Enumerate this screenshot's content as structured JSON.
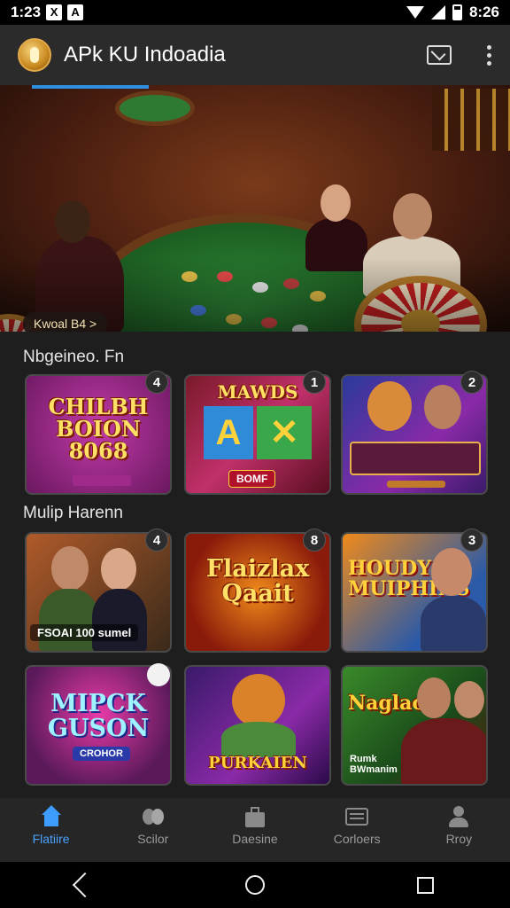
{
  "status_bar": {
    "time": "1:23",
    "right_time": "8:26",
    "notif_icons": [
      "X",
      "A"
    ]
  },
  "app_bar": {
    "title": "APk KU Indoadia",
    "icons": [
      "mail-icon",
      "more-vert-icon"
    ]
  },
  "banner": {
    "chip_label": "Kwoal B4 >"
  },
  "sections": [
    {
      "title": "Nbgeineo. Fn"
    },
    {
      "title": "Mulip Harenn"
    }
  ],
  "cards": [
    {
      "title": "CHILBH\nBOION\n8068",
      "sub": "",
      "badge": "4"
    },
    {
      "title": "MAWDS",
      "sub": "BOMF",
      "badge": "1"
    },
    {
      "title": "",
      "sub": "",
      "badge": "2"
    },
    {
      "title": "",
      "sub": "FSOAI 100 sumel",
      "badge": "4"
    },
    {
      "title": "Flaizlax\nQaait",
      "sub": "",
      "badge": "8"
    },
    {
      "title": "HOUDY\nMUIPHINS",
      "sub": "",
      "badge": "3"
    },
    {
      "title": "MIPCK\nGUSON",
      "sub": "CROHOR",
      "badge": ""
    },
    {
      "title": "PURKAIEN",
      "sub": "",
      "badge": ""
    },
    {
      "title": "Naglao",
      "sub": "Rumk\nBWmanim",
      "badge": ""
    }
  ],
  "bottom_nav": [
    {
      "label": "Flatiire",
      "icon": "home-icon",
      "active": true
    },
    {
      "label": "Scilor",
      "icon": "chips-icon",
      "active": false
    },
    {
      "label": "Daesine",
      "icon": "bag-icon",
      "active": false
    },
    {
      "label": "Corloers",
      "icon": "list-icon",
      "active": false
    },
    {
      "label": "Rroy",
      "icon": "profile-icon",
      "active": false
    }
  ],
  "colors": {
    "accent": "#3f9cff",
    "background": "#1e1e1e",
    "appbar": "#2b2b2b"
  }
}
